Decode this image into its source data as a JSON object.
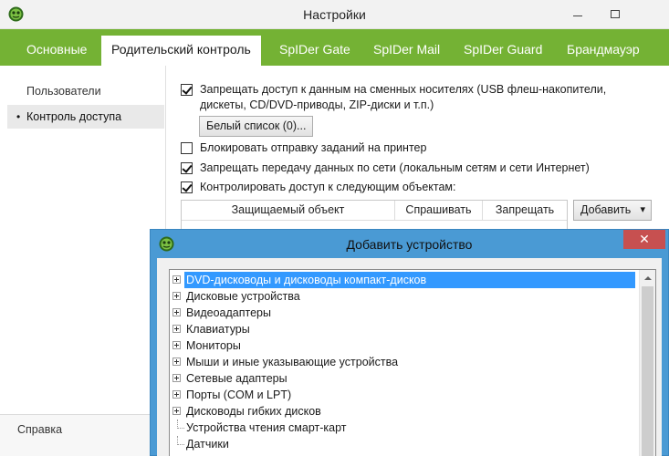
{
  "window": {
    "title": "Настройки",
    "icon": "spider-icon"
  },
  "tabs": [
    {
      "label": "Основные"
    },
    {
      "label": "Родительский контроль",
      "active": true
    },
    {
      "label": "SpIDer Gate"
    },
    {
      "label": "SpIDer Mail"
    },
    {
      "label": "SpIDer Guard"
    },
    {
      "label": "Брандмауэр"
    }
  ],
  "sidebar": {
    "items": [
      {
        "label": "Пользователи"
      },
      {
        "label": "Контроль доступа",
        "selected": true
      }
    ],
    "bullet": "•",
    "help": "Справка"
  },
  "options": {
    "removable": {
      "checked": true,
      "line1": "Запрещать доступ к данным на сменных носителях (USB флеш-накопители,",
      "line2": "дискеты, CD/DVD-приводы, ZIP-диски и т.п.)"
    },
    "whitelist_button": "Белый список (0)...",
    "printer": {
      "checked": false,
      "label": "Блокировать отправку заданий на принтер"
    },
    "network": {
      "checked": true,
      "label": "Запрещать передачу данных по сети (локальным сетям и сети Интернет)"
    },
    "objects": {
      "checked": true,
      "label": "Контролировать доступ к следующим объектам:"
    }
  },
  "table": {
    "columns": [
      "Защищаемый объект",
      "Спрашивать",
      "Запрещать"
    ]
  },
  "add_button": {
    "label": "Добавить",
    "arrow": "▾"
  },
  "dialog": {
    "title": "Добавить устройство",
    "close_glyph": "✕",
    "tree": [
      {
        "label": "DVD-дисководы и дисководы компакт-дисков",
        "expandable": true,
        "selected": true
      },
      {
        "label": "Дисковые устройства",
        "expandable": true
      },
      {
        "label": "Видеоадаптеры",
        "expandable": true
      },
      {
        "label": "Клавиатуры",
        "expandable": true
      },
      {
        "label": "Мониторы",
        "expandable": true
      },
      {
        "label": "Мыши и иные указывающие устройства",
        "expandable": true
      },
      {
        "label": "Сетевые адаптеры",
        "expandable": true
      },
      {
        "label": "Порты (COM и LPT)",
        "expandable": true
      },
      {
        "label": "Дисководы гибких дисков",
        "expandable": true
      },
      {
        "label": "Устройства чтения смарт-карт",
        "expandable": false
      },
      {
        "label": "Датчики",
        "expandable": false
      }
    ]
  },
  "colors": {
    "tab_bar": "#74b234",
    "dialog_frame": "#4a9ad4",
    "selection": "#3399ff",
    "close_button": "#c75050"
  }
}
